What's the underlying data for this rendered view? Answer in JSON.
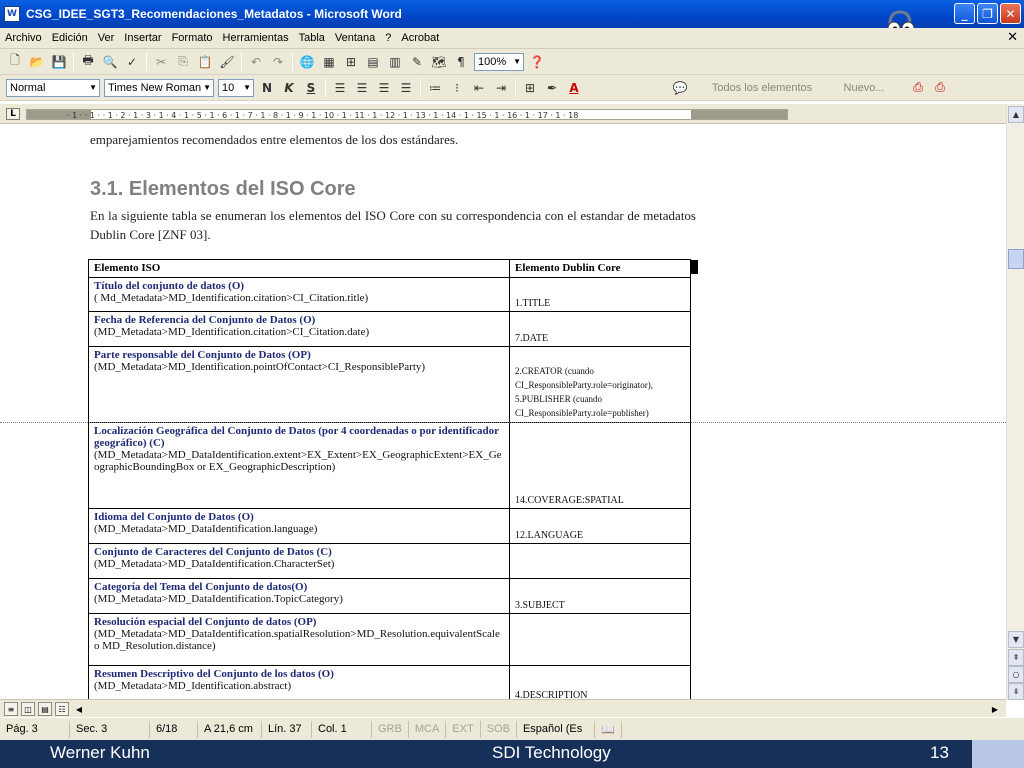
{
  "window": {
    "title": "CSG_IDEE_SGT3_Recomendaciones_Metadatos - Microsoft Word",
    "app_icon_letter": "W",
    "min_glyph": "_",
    "max_glyph": "❐",
    "close_glyph": "✕"
  },
  "menu": {
    "items": [
      "Archivo",
      "Edición",
      "Ver",
      "Insertar",
      "Formato",
      "Herramientas",
      "Tabla",
      "Ventana",
      "?",
      "Acrobat"
    ],
    "close_glyph": "✕"
  },
  "toolbar_standard": {
    "zoom": "100%"
  },
  "toolbar_format": {
    "style": "Normal",
    "font": "Times New Roman",
    "size": "10",
    "bold": "N",
    "italic": "K",
    "underline": "S",
    "elements": "Todos los elementos",
    "new": "Nuevo..."
  },
  "ruler": {
    "numbers": "· 1 · · 1 · · 1 · 2 · 1 · 3 · 1 · 4 · 1 · 5 · 1 · 6 · 1 · 7 · 1 · 8 · 1 · 9 · 1 · 10 · 1 · 11 · 1 · 12 · 1 · 13 · 1 · 14 · 1 · 15 · 1 · 16 · 1 · 17 · 1 · 18"
  },
  "document": {
    "intro_line": "emparejamientos recomendados entre elementos de los dos estándares.",
    "heading": "3.1. Elementos del ISO Core",
    "paragraph": "En la siguiente tabla se enumeran los elementos del ISO Core con su correspondencia con el estandar de metadatos Dublin Core [ZNF 03].",
    "table": {
      "headers": [
        "Elemento ISO",
        "Elemento Dublin Core"
      ],
      "rows": [
        {
          "title": "Título del conjunto de datos (O)",
          "path": "( Md_Metadata>MD_Identification.citation>CI_Citation.title)",
          "dc": "1.TITLE"
        },
        {
          "title": "Fecha de Referencia del Conjunto de Datos (O)",
          "path": "(MD_Metadata>MD_Identification.citation>CI_Citation.date)",
          "dc": "7.DATE"
        },
        {
          "title": "Parte responsable del Conjunto de Datos (OP)",
          "path": "(MD_Metadata>MD_Identification.pointOfContact>CI_ResponsibleParty)",
          "dc": "2.CREATOR (cuando CI_ResponsibleParty.role=originator), 5.PUBLISHER (cuando CI_ResponsibleParty.role=publisher)"
        },
        {
          "title": "Localización Geográfica del Conjunto de Datos (por 4 coordenadas o por identificador geográfico) (C)",
          "path": "(MD_Metadata>MD_DataIdentification.extent>EX_Extent>EX_GeographicExtent>EX_GeographicBoundingBox or EX_GeographicDescription)",
          "dc": "14.COVERAGE:SPATIAL"
        },
        {
          "title": "Idioma del Conjunto de Datos (O)",
          "path": "(MD_Metadata>MD_DataIdentification.language)",
          "dc": "12.LANGUAGE"
        },
        {
          "title": "Conjunto de Caracteres del Conjunto de Datos (C)",
          "path": "(MD_Metadata>MD_DataIdentification.CharacterSet)",
          "dc": ""
        },
        {
          "title": "Categoría del Tema del Conjunto de datos(O)",
          "path": "(MD_Metadata>MD_DataIdentification.TopicCategory)",
          "dc": "3.SUBJECT"
        },
        {
          "title": "Resolución espacial del Conjunto de datos (OP)",
          "path": "(MD_Metadata>MD_DataIdentification.spatialResolution>MD_Resolution.equivalentScale o MD_Resolution.distance)",
          "dc": ""
        },
        {
          "title": "Resumen Descriptivo  del Conjunto de los datos (O)",
          "path": "(MD_Metadata>MD_Identification.abstract)",
          "dc": "4.DESCRIPTION"
        }
      ]
    }
  },
  "status": {
    "page": "Pág. 3",
    "section": "Sec. 3",
    "count": "6/18",
    "position": "A 21,6 cm",
    "line": "Lín. 37",
    "col": "Col. 1",
    "grb": "GRB",
    "mca": "MCA",
    "ext": "EXT",
    "sob": "SOB",
    "language": "Español (Es"
  },
  "footer": {
    "author": "Werner Kuhn",
    "topic": "SDI Technology",
    "page": "13"
  }
}
